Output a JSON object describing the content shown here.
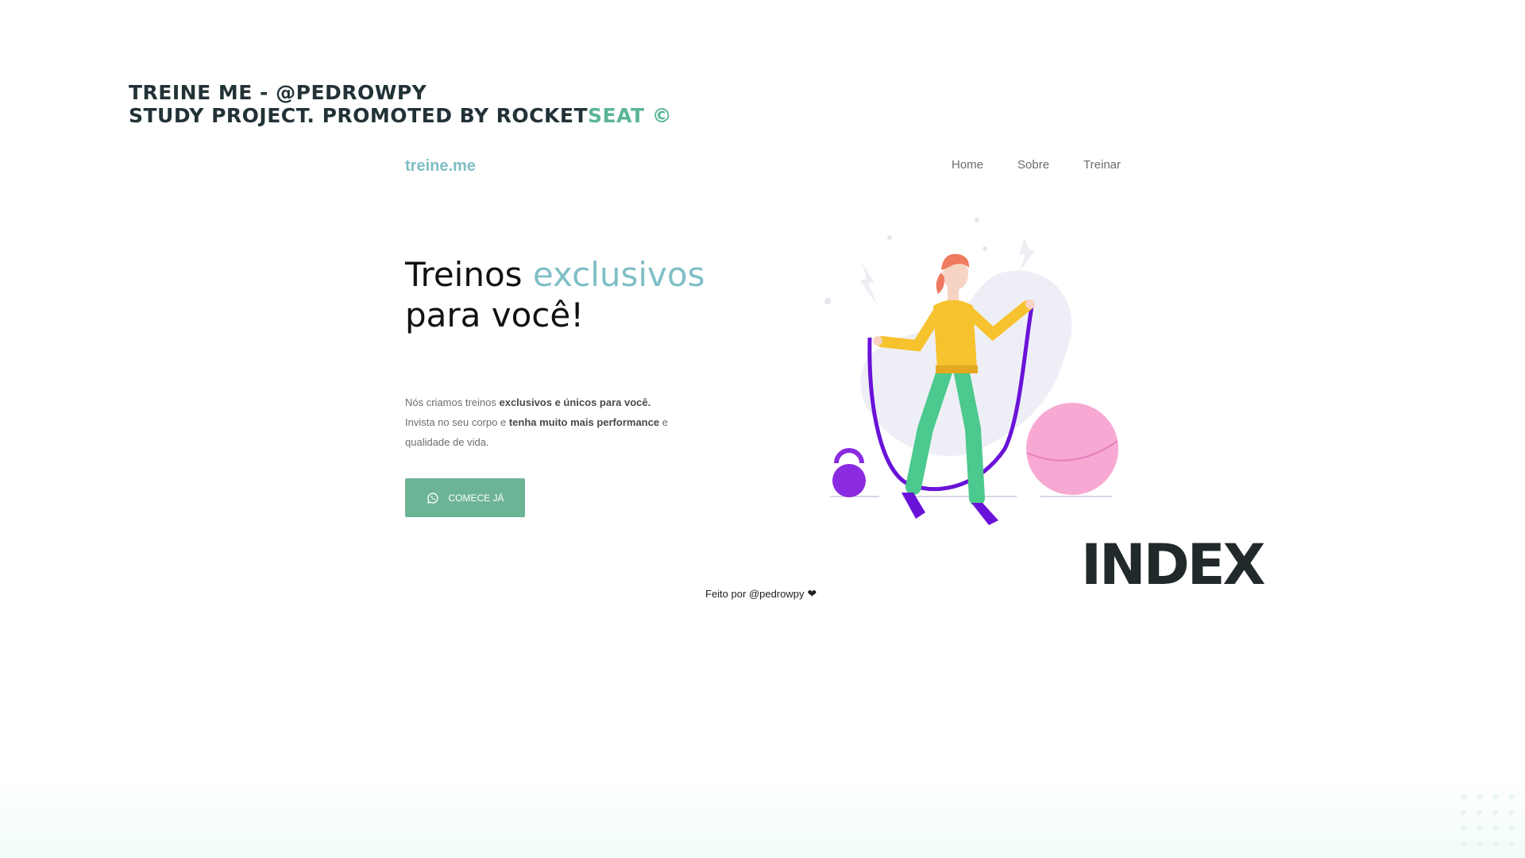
{
  "header": {
    "line1": "TREINE ME - @PEDROWPY",
    "line2_prefix": "STUDY PROJECT. PROMOTED BY ROCKET",
    "line2_accent": "SEAT ©"
  },
  "navbar": {
    "brand": "treine.me",
    "items": [
      "Home",
      "Sobre",
      "Treinar"
    ]
  },
  "hero": {
    "title_part1": "Treinos ",
    "title_accent": "exclusivos",
    "title_part2": "para você!",
    "desc1_a": "Nós criamos treinos ",
    "desc1_b": "exclusivos e únicos para você.",
    "desc2_a": "Invista no seu corpo e ",
    "desc2_b": "tenha muito mais performance",
    "desc2_c": " e",
    "desc3": "qualidade de vida.",
    "cta_label": "COMECE JÁ",
    "cta_icon": "whatsapp-icon"
  },
  "illustration": {
    "icon": "woman-jump-rope-illustration"
  },
  "page_label": "INDEX",
  "footer": {
    "text": "Feito por @pedrowpy",
    "icon": "heart-icon"
  },
  "colors": {
    "accent_teal": "#7fbfc6",
    "accent_green": "#5bb597",
    "button_green": "#6db496",
    "dark": "#223237"
  }
}
